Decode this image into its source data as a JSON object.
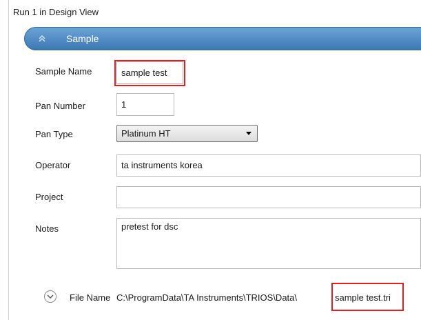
{
  "window": {
    "title": "Run 1 in Design View"
  },
  "section": {
    "label": "Sample"
  },
  "fields": {
    "sample_name": {
      "label": "Sample Name",
      "value": "sample test"
    },
    "pan_number": {
      "label": "Pan Number",
      "value": "1"
    },
    "pan_type": {
      "label": "Pan Type",
      "value": "Platinum HT"
    },
    "operator": {
      "label": "Operator",
      "value": "ta instruments korea"
    },
    "project": {
      "label": "Project",
      "value": ""
    },
    "notes": {
      "label": "Notes",
      "value": "pretest for dsc"
    }
  },
  "file": {
    "label": "File Name",
    "path": "C:\\ProgramData\\TA Instruments\\TRIOS\\Data\\",
    "name": "sample test.tri"
  },
  "colors": {
    "header": "#4a87c2",
    "highlight": "#e02020"
  },
  "icons": {
    "collapse": "chevron-up-double-icon",
    "expand": "chevron-down-circle-icon"
  }
}
